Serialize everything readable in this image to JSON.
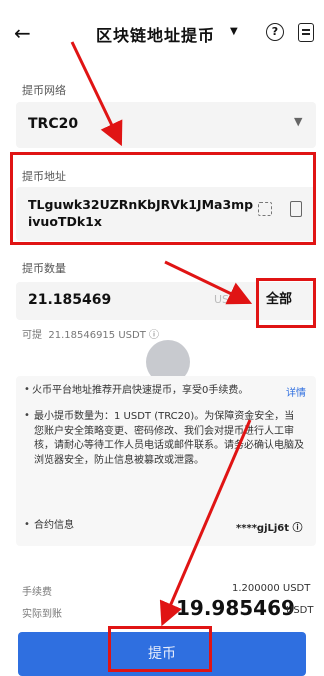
{
  "header": {
    "back_icon": "arrow-left-icon",
    "title": "区块链地址提币",
    "help_icon": "question-circle-icon",
    "record_icon": "record-list-icon"
  },
  "network": {
    "label": "提币网络",
    "value": "TRC20"
  },
  "address": {
    "label": "提币地址",
    "value": "TLguwk32UZRnKbJRVk1JMa3mpivuoTDk1x"
  },
  "quantity": {
    "label": "提币数量",
    "value": "21.185469",
    "unit": "USDT",
    "all_label": "全部",
    "available_label": "可提",
    "available_value": "21.18546915 USDT"
  },
  "notice": {
    "line1": "火币平台地址推荐开启快速提币，享受0手续费。",
    "line1_link": "详情",
    "line2": "最小提币数量为：1 USDT (TRC20)。为保障资金安全，当您账户安全策略变更、密码修改、我们会对提币进行人工审核，请耐心等待工作人员电话或邮件联系。请务必确认电脑及浏览器安全，防止信息被篡改或泄露。",
    "contract_label": "合约信息",
    "contract_value": "****gjLj6t"
  },
  "fees": {
    "fee_label": "手续费",
    "fee_value": "1.200000 USDT",
    "actual_label": "实际到账",
    "actual_amount": "19.985469",
    "actual_unit": "USDT"
  },
  "submit_label": "提币",
  "colors": {
    "accent": "#2f6fe0",
    "annotation_red": "#e01414"
  }
}
